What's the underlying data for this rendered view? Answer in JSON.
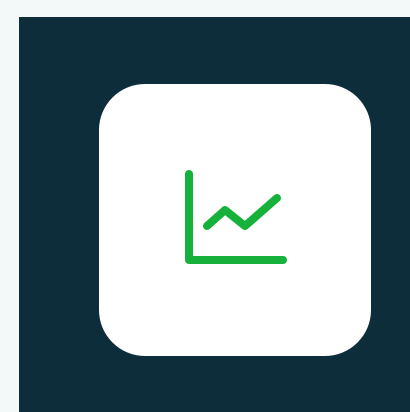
{
  "app": {
    "icon": "chart-line-icon",
    "colors": {
      "page_background": "#f3f9f9",
      "panel_background": "#0d2d3a",
      "tile_background": "#ffffff",
      "icon_stroke": "#16b13a"
    }
  }
}
